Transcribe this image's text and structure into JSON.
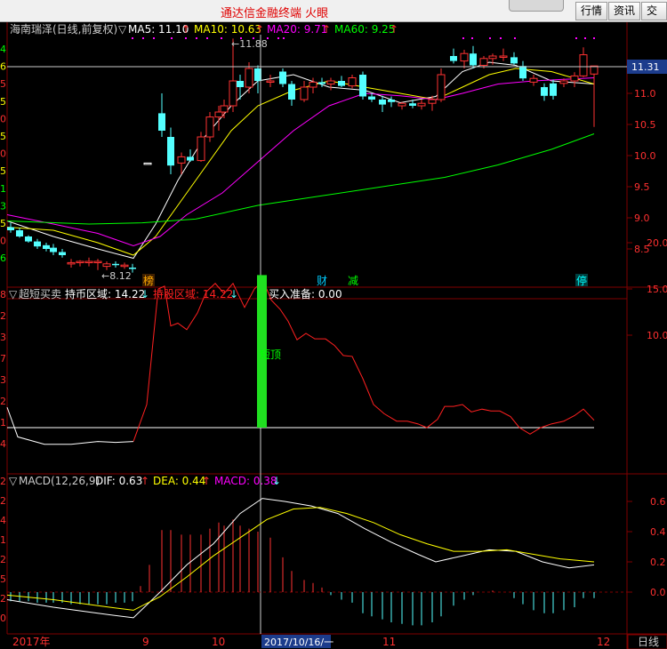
{
  "app": {
    "title": "通达信金融终端 火眼"
  },
  "toolbar": {
    "quote": "行情",
    "news": "资讯",
    "trade": "交易"
  },
  "stock": {
    "name": "海南瑞泽",
    "period": "日线",
    "adjust": "前复权"
  },
  "price_panel": {
    "header_name": "海南瑞泽(日线,前复权)",
    "ma": [
      {
        "label": "MA5: 11.10",
        "color": "#ffffff"
      },
      {
        "label": "MA10: 10.63",
        "color": "#ffff00"
      },
      {
        "label": "MA20: 9.71",
        "color": "#ff00ff"
      },
      {
        "label": "MA60: 9.25",
        "color": "#00ff00"
      }
    ],
    "y_ticks": [
      "11.0",
      "10.5",
      "10.0",
      "9.5",
      "9.0",
      "8.5"
    ],
    "y_values": [
      11.0,
      10.5,
      10.0,
      9.5,
      9.0,
      8.5
    ],
    "last_price": "11.31",
    "high_marker": "11.88",
    "low_marker": "8.12",
    "events": [
      {
        "label": "榜",
        "color": "#ffaa00"
      },
      {
        "label": "财",
        "color": "#00ccff"
      },
      {
        "label": "减",
        "color": "#00ff00"
      },
      {
        "label": "停",
        "color": "#00ffff"
      }
    ],
    "left_margin_digits": [
      "4",
      "6",
      "5",
      "5",
      "0",
      "5",
      "0",
      "5",
      "1",
      "3",
      "5",
      "0",
      "6"
    ]
  },
  "indicator1": {
    "name": "超短买卖",
    "hold_label": "持币区域: 14.22",
    "hold_color": "#ffffff",
    "stock_label": "持股区域: 14.22",
    "stock_color": "#ff2020",
    "ready_label": "买入准备: 0.00",
    "ready_color": "#ffffff",
    "annotation": "短顶",
    "y_ticks": [
      "20.0",
      "15.0",
      "10.0"
    ],
    "left_margin_digits": [
      "8",
      "2",
      "3",
      "7",
      "3",
      "2",
      "1",
      "4"
    ]
  },
  "macd": {
    "name": "MACD(12,26,9)",
    "dif_label": "DIF: 0.63",
    "dea_label": "DEA: 0.44",
    "macd_label": "MACD: 0.38",
    "y_ticks": [
      "0.6",
      "0.4",
      "0.2",
      "0.0"
    ],
    "left_margin_digits": [
      "2",
      "2",
      "4",
      "1",
      "2",
      "5",
      "2",
      "0"
    ]
  },
  "timeline": {
    "labels": [
      "2017年",
      "9",
      "10",
      "11",
      "12"
    ],
    "cursor_date": "2017/10/16/一",
    "period_button": "日线"
  },
  "colors": {
    "up": "#ff3232",
    "down": "#54ffff",
    "grid": "#800000"
  }
}
